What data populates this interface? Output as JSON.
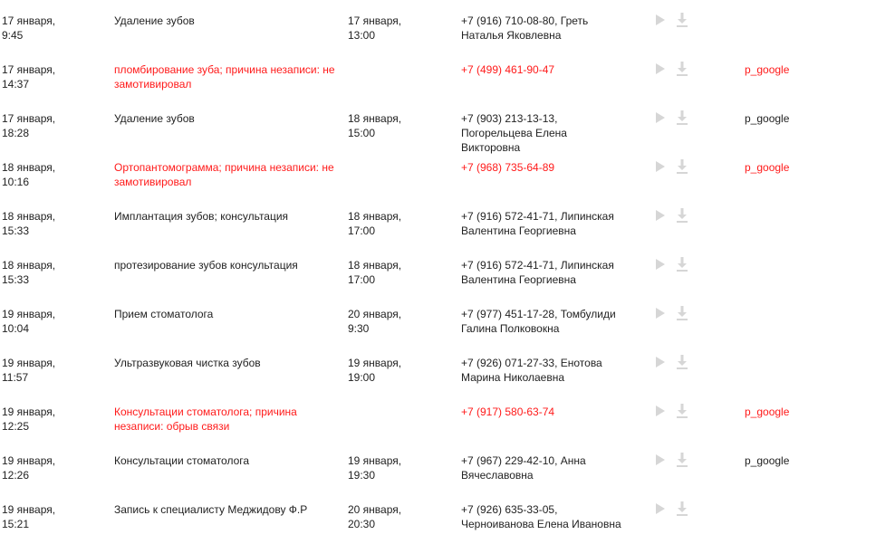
{
  "rows": [
    {
      "created": [
        "17 января,",
        "9:45"
      ],
      "service": "Удаление зубов",
      "appointment": [
        "17 января,",
        "13:00"
      ],
      "client": [
        "+7 (916) 710-08-80, Греть",
        "Наталья Яковлевна"
      ],
      "source": "",
      "missed": false
    },
    {
      "created": [
        "17 января,",
        "14:37"
      ],
      "service": "пломбирование зуба; причина незаписи: не замотивировал",
      "appointment": [
        "",
        ""
      ],
      "client": [
        "+7 (499) 461-90-47",
        ""
      ],
      "source": "p_google",
      "missed": true
    },
    {
      "created": [
        "17 января,",
        "18:28"
      ],
      "service": "Удаление зубов",
      "appointment": [
        "18 января,",
        "15:00"
      ],
      "client": [
        "+7 (903) 213-13-13,",
        "Погорельцева Елена",
        "Викторовна"
      ],
      "source": "p_google",
      "missed": false
    },
    {
      "created": [
        "18 января,",
        "10:16"
      ],
      "service": "Ортопантомограмма; причина незаписи: не замотивировал",
      "appointment": [
        "",
        ""
      ],
      "client": [
        "+7 (968) 735-64-89",
        ""
      ],
      "source": "p_google",
      "missed": true
    },
    {
      "created": [
        "18 января,",
        "15:33"
      ],
      "service": "Имплантация зубов; консультация",
      "appointment": [
        "18 января,",
        "17:00"
      ],
      "client": [
        "+7 (916) 572-41-71, Липинская",
        "Валентина Георгиевна"
      ],
      "source": "",
      "missed": false
    },
    {
      "created": [
        "18 января,",
        "15:33"
      ],
      "service": "протезирование зубов консультация",
      "appointment": [
        "18 января,",
        "17:00"
      ],
      "client": [
        "+7 (916) 572-41-71, Липинская",
        "Валентина Георгиевна"
      ],
      "source": "",
      "missed": false
    },
    {
      "created": [
        "19 января,",
        "10:04"
      ],
      "service": "Прием стоматолога",
      "appointment": [
        "20 января,",
        "9:30"
      ],
      "client": [
        "+7 (977) 451-17-28, Томбулиди",
        "Галина Полковокна"
      ],
      "source": "",
      "missed": false
    },
    {
      "created": [
        "19 января,",
        "11:57"
      ],
      "service": "Ультразвуковая чистка зубов",
      "appointment": [
        "19 января,",
        "19:00"
      ],
      "client": [
        "+7 (926) 071-27-33, Енотова",
        "Марина Николаевна"
      ],
      "source": "",
      "missed": false
    },
    {
      "created": [
        "19 января,",
        "12:25"
      ],
      "service": "Консультации стоматолога; причина незаписи: обрыв связи",
      "appointment": [
        "",
        ""
      ],
      "client": [
        "+7 (917) 580-63-74",
        ""
      ],
      "source": "p_google",
      "missed": true
    },
    {
      "created": [
        "19 января,",
        "12:26"
      ],
      "service": "Консультации стоматолога",
      "appointment": [
        "19 января,",
        "19:30"
      ],
      "client": [
        "+7 (967) 229-42-10, Анна",
        "Вячеславовна"
      ],
      "source": "p_google",
      "missed": false
    },
    {
      "created": [
        "19 января,",
        "15:21"
      ],
      "service": "Запись к специалисту Меджидову Ф.Р",
      "appointment": [
        "20 января,",
        "20:30"
      ],
      "client": [
        "+7 (926) 635-33-05,",
        "Черноиванова Елена Ивановна"
      ],
      "source": "",
      "missed": false
    }
  ],
  "icons": {
    "play": "play-icon",
    "download": "download-icon"
  },
  "colors": {
    "text": "#222222",
    "missed": "#ff1a1a",
    "icon": "#d6d6d6"
  }
}
